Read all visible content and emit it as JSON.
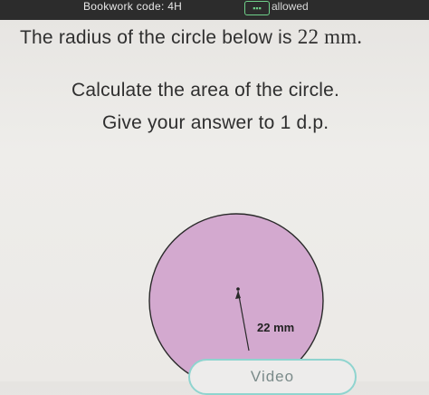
{
  "header": {
    "bookwork_label": "Bookwork code: 4H",
    "calculator_icon": "calculator-icon",
    "calculator_status": "allowed"
  },
  "question": {
    "line1_prefix": "The radius of the circle below is ",
    "line1_value": "22 mm.",
    "line2": "Calculate the area of the circle.",
    "line3": "Give your answer to 1 d.p."
  },
  "diagram": {
    "radius_label": "22 mm",
    "fill_color": "#d3a9cf",
    "stroke_color": "#2a2a2a"
  },
  "footer": {
    "video_button_label": "Video"
  }
}
